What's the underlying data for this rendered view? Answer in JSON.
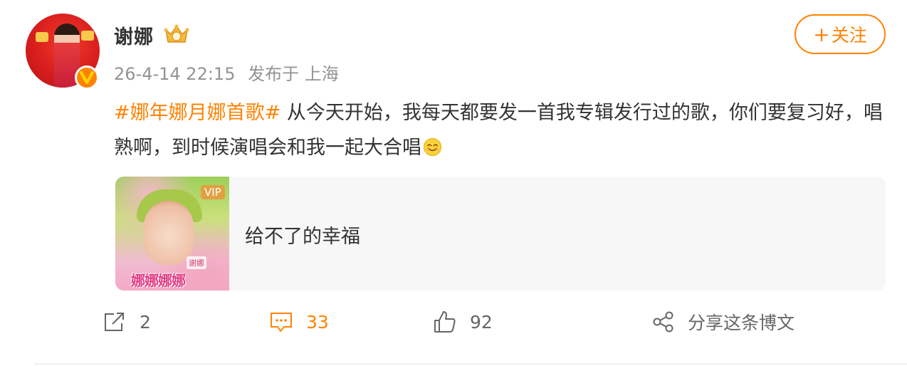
{
  "post": {
    "author": {
      "name": "谢娜",
      "avatar_icon": "avatar-image",
      "verified_icon": "v-verified-badge",
      "member_icon": "crown-badge-icon"
    },
    "time": "26-4-14 22:15",
    "source": "发布于 上海",
    "follow_label": "关注",
    "content": {
      "topic": "#娜年娜月娜首歌#",
      "text": " 从今天开始，我每天都要发一首我专辑发行过的歌，你们要复习好，唱熟啊，到时候演唱会和我一起大合唱",
      "emoji": "smile-emoji"
    },
    "music_card": {
      "vip_label": "VIP",
      "cover_artist": "谢娜",
      "cover_album": "娜娜娜娜",
      "song_title": "给不了的幸福"
    },
    "actions": {
      "repost_count": "2",
      "comment_count": "33",
      "like_count": "92",
      "share_label": "分享这条博文"
    }
  },
  "colors": {
    "accent": "#ff8200",
    "text": "#333333",
    "meta": "#939393",
    "card_bg": "#f7f7f7"
  }
}
